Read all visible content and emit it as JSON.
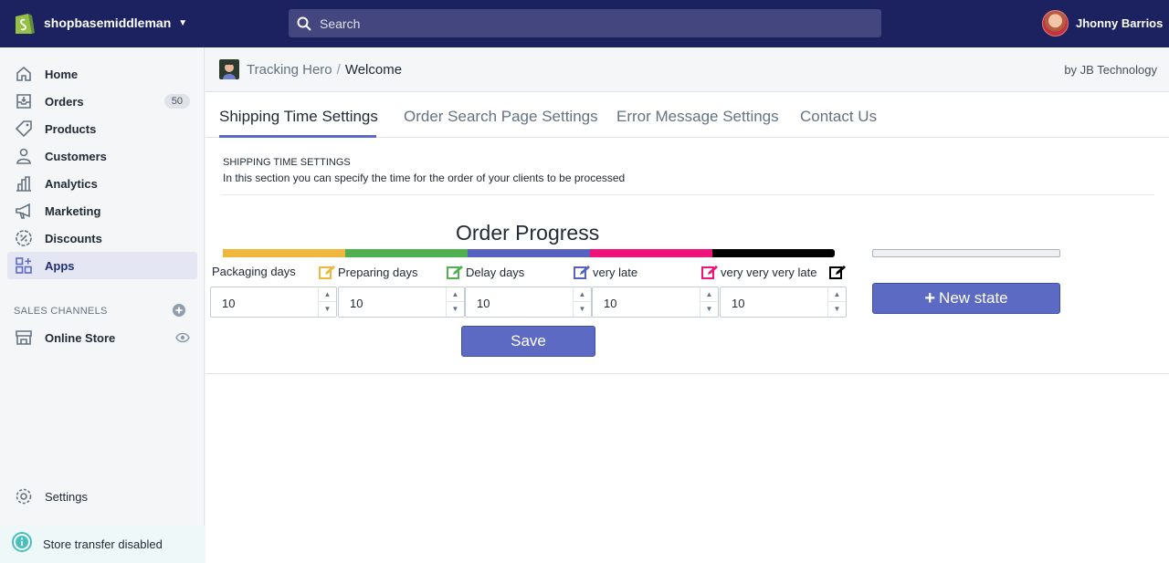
{
  "topbar": {
    "store_name": "shopbasemiddleman",
    "search_placeholder": "Search",
    "user_name": "Jhonny Barrios"
  },
  "sidebar": {
    "items": [
      {
        "label": "Home",
        "icon": "home-icon"
      },
      {
        "label": "Orders",
        "icon": "orders-icon",
        "badge": "50"
      },
      {
        "label": "Products",
        "icon": "tag-icon"
      },
      {
        "label": "Customers",
        "icon": "person-icon"
      },
      {
        "label": "Analytics",
        "icon": "bar-chart-icon"
      },
      {
        "label": "Marketing",
        "icon": "megaphone-icon"
      },
      {
        "label": "Discounts",
        "icon": "discount-icon"
      },
      {
        "label": "Apps",
        "icon": "apps-icon",
        "active": true
      }
    ],
    "sales_channels_label": "SALES CHANNELS",
    "online_store_label": "Online Store",
    "settings_label": "Settings",
    "transfer_label": "Store transfer disabled"
  },
  "appbar": {
    "app_name": "Tracking Hero",
    "separator": "/",
    "page": "Welcome",
    "byline": "by JB Technology"
  },
  "tabs": [
    {
      "label": "Shipping Time Settings",
      "active": true
    },
    {
      "label": "Order Search Page Settings"
    },
    {
      "label": "Error Message Settings"
    },
    {
      "label": "Contact Us"
    }
  ],
  "section": {
    "title": "SHIPPING TIME SETTINGS",
    "description": "In this section you can specify the time for the order of your clients to be processed"
  },
  "progress": {
    "title": "Order Progress",
    "stages": [
      {
        "label": "Packaging days",
        "value": "10",
        "color": "#f0b73d"
      },
      {
        "label": "Preparing days",
        "value": "10",
        "color": "#50b050"
      },
      {
        "label": "Delay days",
        "value": "10",
        "color": "#5661c0"
      },
      {
        "label": "very late",
        "value": "10",
        "color": "#f0137a"
      },
      {
        "label": "very very very late",
        "value": "10",
        "color": "#000000"
      }
    ],
    "save_label": "Save",
    "new_state_label": "New state"
  },
  "colors": {
    "topbar": "#1c2260",
    "accent": "#5c6ac4"
  }
}
